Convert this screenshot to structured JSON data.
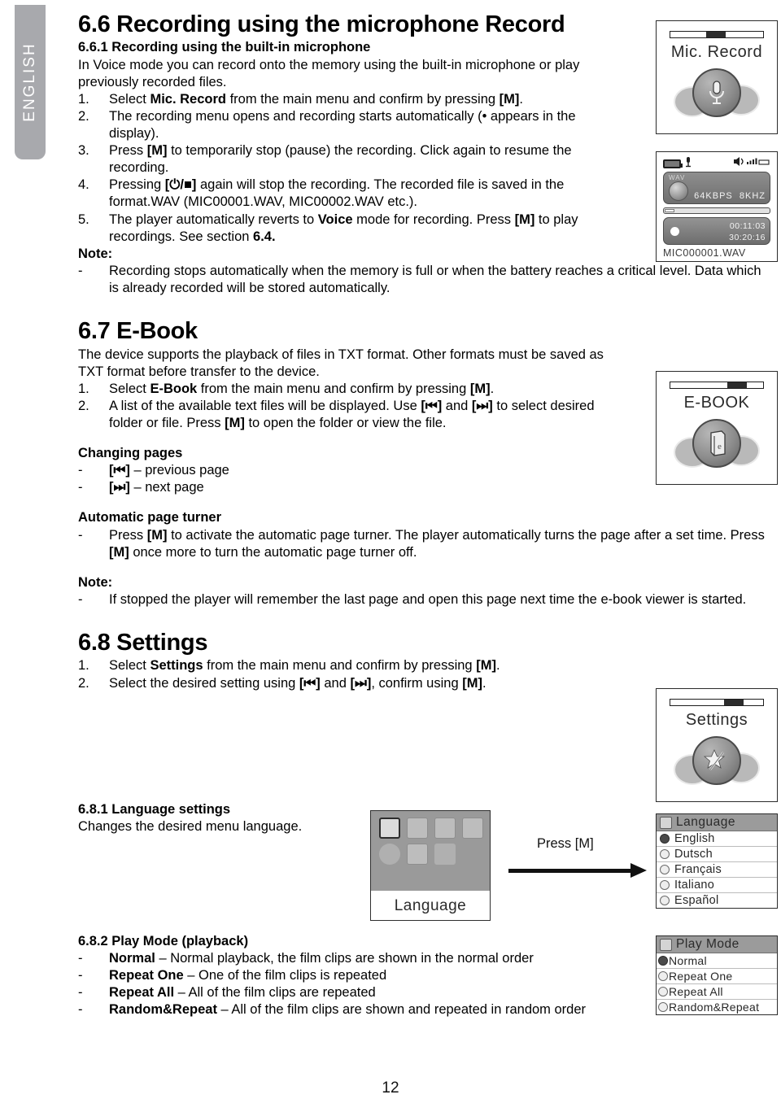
{
  "sidebar": {
    "language_tab": "ENGLISH"
  },
  "footer": {
    "page_number": "12"
  },
  "sections": {
    "mic_record": {
      "heading": "6.6 Recording using the microphone Record",
      "subheading": "6.6.1 Recording using the built-in microphone",
      "intro": "In Voice mode you can record onto the memory using the built-in microphone or play previously recorded files.",
      "steps": [
        {
          "marker": "1.",
          "text": "Select Mic. Record from the main menu and confirm by pressing [M]."
        },
        {
          "marker": "2.",
          "text": "The recording menu opens and recording starts automatically (• appears in the display)."
        },
        {
          "marker": "3.",
          "text": "Press [M] to temporarily stop (pause) the recording. Click again to resume the recording."
        },
        {
          "marker": "4.",
          "text": "Pressing [⏻/■] again will stop the recording. The recorded file is saved in the format.WAV (MIC00001.WAV, MIC00002.WAV etc.)."
        },
        {
          "marker": "5.",
          "text": "The player automatically reverts to Voice mode for recording. Press [M] to play recordings. See section 6.4."
        }
      ],
      "note_label": "Note:",
      "notes": [
        {
          "marker": "-",
          "text": "Recording stops automatically when the memory is full or when the battery reaches a critical level. Data which is already recorded will be stored automatically."
        }
      ]
    },
    "ebook": {
      "heading": "6.7 E-Book",
      "intro": "The device supports the playback of files in TXT format. Other formats must be saved as TXT format before transfer to the device.",
      "steps": [
        {
          "marker": "1.",
          "text": "Select E-Book from the main menu and confirm by pressing [M]."
        },
        {
          "marker": "2.",
          "text": "A list of the available text files will be displayed. Use [⏮] and [⏭] to select desired folder or file. Press [M] to open the folder or view the file."
        }
      ],
      "changing_pages_label": "Changing pages",
      "changing_pages": [
        {
          "marker": "-",
          "text": "[⏮] – previous page"
        },
        {
          "marker": "-",
          "text": "[⏭] – next page"
        }
      ],
      "auto_turner_label": "Automatic page turner",
      "auto_turner": [
        {
          "marker": "-",
          "text": "Press [M] to activate the automatic page turner. The player automatically turns the page after a set time. Press [M] once more to turn the automatic page turner off."
        }
      ],
      "note_label": "Note:",
      "notes": [
        {
          "marker": "-",
          "text": "If stopped the player will remember the last page and open this page next time the e-book viewer is started."
        }
      ]
    },
    "settings": {
      "heading": "6.8 Settings",
      "steps": [
        {
          "marker": "1.",
          "text": "Select Settings from the main menu and confirm by pressing [M]."
        },
        {
          "marker": "2.",
          "text": "Select the desired setting using [⏮] and [⏭], confirm using [M]."
        }
      ]
    },
    "language_settings": {
      "heading": "6.8.1 Language settings",
      "text": "Changes the desired menu language.",
      "press_label": "Press [M]"
    },
    "play_mode": {
      "heading": "6.8.2 Play Mode (playback)",
      "items": [
        {
          "marker": "-",
          "term": "Normal",
          "desc": " – Normal playback, the film clips are shown in the normal order"
        },
        {
          "marker": "-",
          "term": "Repeat One",
          "desc": " – One of the film clips is repeated"
        },
        {
          "marker": "-",
          "term": "Repeat All",
          "desc": " – All of the film clips are repeated"
        },
        {
          "marker": "-",
          "term": "Random&Repeat",
          "desc": " – All of the film clips are shown and repeated in random order"
        }
      ]
    }
  },
  "screenshots": {
    "mic_record_menu": {
      "title": "Mic. Record",
      "icon": "microphone-icon"
    },
    "recording_screen": {
      "format_tag": "WAV",
      "bitrate": "64KBPS",
      "samplerate": "8KHZ",
      "elapsed_time": "00:11:03",
      "total_time": "30:20:16",
      "filename": "MIC000001.WAV"
    },
    "ebook_menu": {
      "title": "E-BOOK",
      "icon": "book-icon"
    },
    "settings_menu": {
      "title": "Settings",
      "icon": "star-wand-icon"
    },
    "language_thumb": {
      "caption": "Language"
    },
    "language_list": {
      "title": "Language",
      "options": [
        {
          "label": "English",
          "selected": true
        },
        {
          "label": "Dutsch",
          "selected": false
        },
        {
          "label": "Français",
          "selected": false
        },
        {
          "label": "Italiano",
          "selected": false
        },
        {
          "label": "Español",
          "selected": false
        }
      ]
    },
    "play_mode_list": {
      "title": "Play Mode",
      "options": [
        {
          "label": "Normal",
          "selected": true
        },
        {
          "label": "Repeat One",
          "selected": false
        },
        {
          "label": "Repeat All",
          "selected": false
        },
        {
          "label": "Random&Repeat",
          "selected": false
        }
      ]
    }
  }
}
